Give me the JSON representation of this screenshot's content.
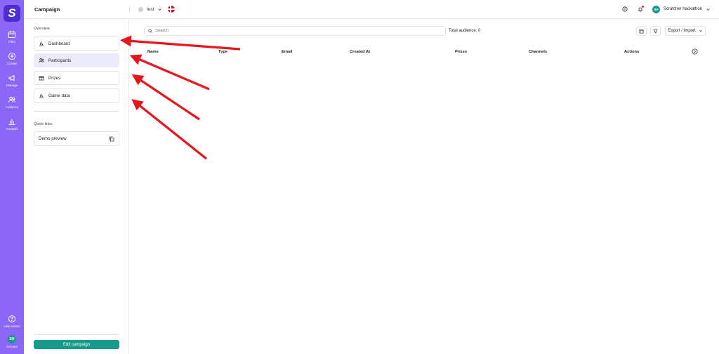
{
  "rail": {
    "logo": "S",
    "items": [
      {
        "label": "Files",
        "icon": "calendar-icon"
      },
      {
        "label": "Create",
        "icon": "plus-circle-icon"
      },
      {
        "label": "Manage",
        "icon": "megaphone-icon"
      },
      {
        "label": "Audience",
        "icon": "users-icon"
      },
      {
        "label": "Analysis",
        "icon": "bar-chart-icon"
      }
    ],
    "help": "Help center",
    "account": "Account",
    "account_initials": "SH"
  },
  "header": {
    "title": "Campaign",
    "campaign_name": "test",
    "user_name": "Scratcher hackathon",
    "user_initials": "SH"
  },
  "sidebar": {
    "overview_label": "Overview",
    "items": [
      {
        "label": "Dashboard",
        "icon": "bar-chart-icon"
      },
      {
        "label": "Participants",
        "icon": "users-icon"
      },
      {
        "label": "Prizes",
        "icon": "gift-icon"
      },
      {
        "label": "Game data",
        "icon": "bar-chart-icon"
      }
    ],
    "quick_links_label": "Quick links",
    "demo_preview": "Demo preview",
    "edit_button": "Edit campaign"
  },
  "main": {
    "search_placeholder": "Search",
    "total_audience": "Total audience: 0",
    "export_label": "Export / Import",
    "columns": [
      "Name",
      "Type",
      "Email",
      "Created At",
      "Prizes",
      "Channels",
      "Actions"
    ]
  },
  "colors": {
    "rail": "#8c66f4",
    "accent": "#179a8c",
    "active_nav": "#ecebfb",
    "arrow": "#e8161c"
  }
}
